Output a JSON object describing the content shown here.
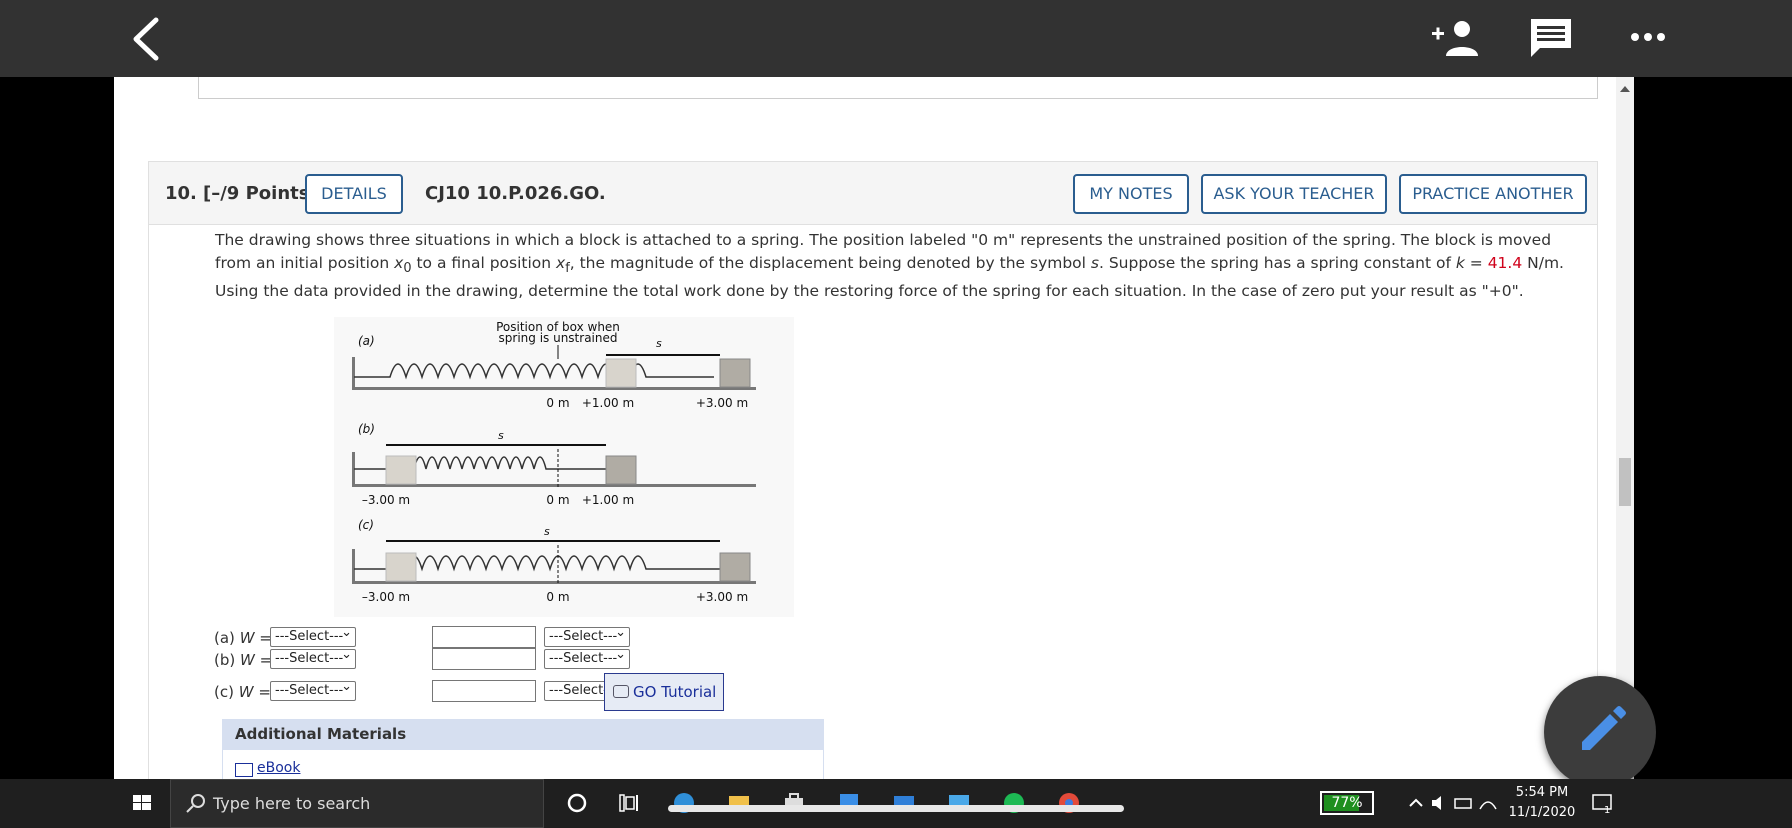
{
  "topbar": {
    "back_icon": "chevron-left-icon",
    "add_person_icon": "add-person-icon",
    "comment_icon": "comment-icon",
    "more_icon": "more-icon"
  },
  "question": {
    "number": "10.",
    "points": "[–/9 Points]",
    "details_label": "DETAILS",
    "code": "CJ10 10.P.026.GO.",
    "my_notes_label": "MY NOTES",
    "ask_teacher_label": "ASK YOUR TEACHER",
    "practice_label": "PRACTICE ANOTHER",
    "text_1": "The drawing shows three situations in which a block is attached to a spring. The position labeled \"0 m\" represents the unstrained position of the spring. The block is moved from an initial position ",
    "x0": "x",
    "x0_sub": "0",
    "text_2": " to a final position ",
    "xf": "x",
    "xf_sub": "f",
    "text_3": ", the magnitude of the displacement being denoted by the symbol ",
    "s": "s",
    "text_4": ". Suppose the spring has a spring constant of ",
    "k": "k",
    "text_5": " = ",
    "k_value": "41.4",
    "text_6": " N/m. Using the data provided in the drawing, determine the total work done by the restoring force of the spring for each situation. In the case of zero put your result as \"+0\"."
  },
  "figure": {
    "caption_1": "Position of box when",
    "caption_2": "spring is unstrained",
    "a": {
      "label": "(a)",
      "s": "s",
      "ticks": [
        "0 m",
        "+1.00 m",
        "+3.00 m"
      ]
    },
    "b": {
      "label": "(b)",
      "s": "s",
      "ticks": [
        "–3.00 m",
        "0 m",
        "+1.00 m"
      ]
    },
    "c": {
      "label": "(c)",
      "s": "s",
      "ticks": [
        "–3.00 m",
        "0 m",
        "+3.00 m"
      ]
    }
  },
  "answers": [
    {
      "label": "(a)",
      "var": "W",
      "eq": " = ",
      "sign": "---Select---",
      "unit": "---Select---"
    },
    {
      "label": "(b)",
      "var": "W",
      "eq": " = ",
      "sign": "---Select---",
      "unit": "---Select---"
    },
    {
      "label": "(c)",
      "var": "W",
      "eq": " = ",
      "sign": "---Select---",
      "unit": "---Select---"
    }
  ],
  "go_tutorial_label": "GO Tutorial",
  "additional": {
    "title": "Additional Materials",
    "ebook": "eBook"
  },
  "fab_icon": "pencil-icon",
  "taskbar": {
    "search_placeholder": "Type here to search",
    "battery": "77%",
    "battery_level": 0.77,
    "time": "5:54 PM",
    "date": "11/1/2020",
    "notification_count": "1"
  }
}
